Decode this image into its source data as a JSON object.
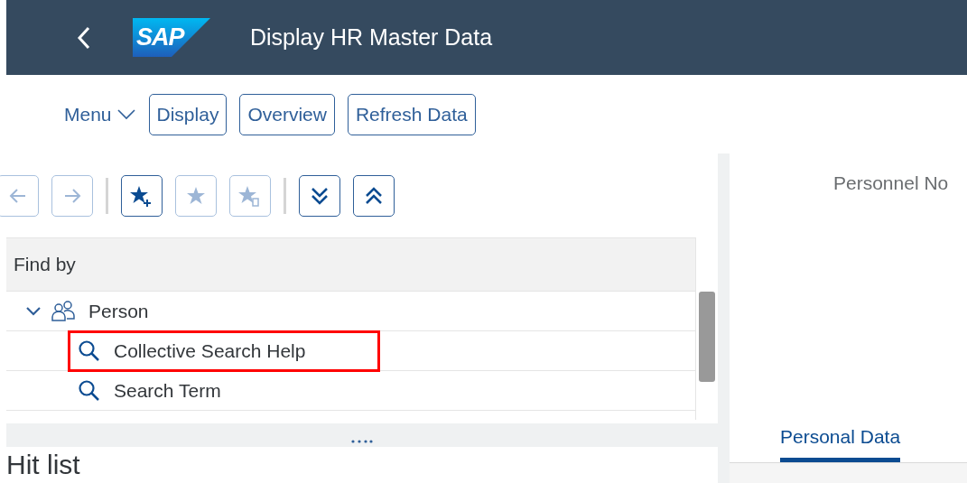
{
  "shell_bar": {
    "logo": "SAP",
    "title": "Display HR Master Data"
  },
  "toolbar": {
    "menu": "Menu",
    "buttons": [
      "Display",
      "Overview",
      "Refresh Data"
    ]
  },
  "navigation_toolbar": {
    "groups": [
      [
        {
          "kind": "back",
          "disabled": true
        },
        {
          "kind": "forward",
          "disabled": true
        }
      ],
      [
        {
          "kind": "add-favorite",
          "disabled": false
        },
        {
          "kind": "favorite",
          "disabled": true
        },
        {
          "kind": "delete-favorite",
          "disabled": true
        }
      ],
      [
        {
          "kind": "expand-all",
          "disabled": false
        },
        {
          "kind": "collapse-all",
          "disabled": false
        }
      ]
    ]
  },
  "find_by": {
    "header": "Find by",
    "tree": [
      {
        "label": "Person",
        "kind": "group",
        "expanded": true,
        "highlighted": false,
        "children": [
          {
            "label": "Collective Search Help",
            "kind": "search",
            "highlighted": true
          },
          {
            "label": "Search Term",
            "kind": "search",
            "highlighted": false
          }
        ]
      }
    ]
  },
  "hit_list": {
    "title": "Hit list"
  },
  "detail": {
    "field_label": "Personnel No",
    "tabs": [
      {
        "label": "Personal Data",
        "selected": true
      }
    ]
  }
}
